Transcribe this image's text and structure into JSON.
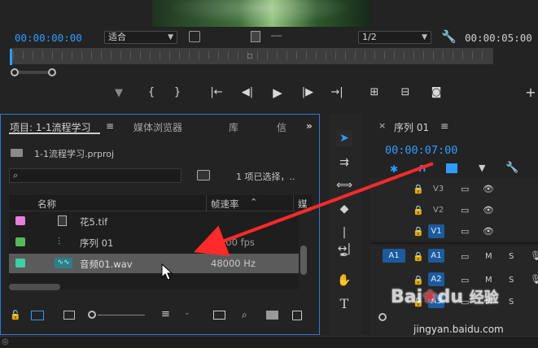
{
  "monitor": {
    "current_time": "00:00:00:00",
    "fit_label": "适合",
    "resolution": "1/2",
    "duration": "00:00:05:00"
  },
  "project_panel": {
    "tab_project": "项目: 1-1流程学习",
    "tab_media_browser": "媒体浏览器",
    "tab_library": "库",
    "tab_info": "信",
    "file_name": "1-1流程学习.prproj",
    "selection_status": "1 项已选择，..",
    "col_name": "名称",
    "col_framerate": "帧速率",
    "col_media": "媒",
    "items": [
      {
        "name": "花5.tif",
        "rate": "",
        "color": "#e680d8"
      },
      {
        "name": "序列 01",
        "rate": "25.00 fps",
        "color": "#58b85a"
      },
      {
        "name": "音频01.wav",
        "rate": "48000 Hz",
        "color": "#3ecfa3"
      }
    ]
  },
  "timeline": {
    "tab_label": "序列 01",
    "timecode": "00:00:07:00",
    "video_tracks": [
      "V3",
      "V2",
      "V1"
    ],
    "audio_tracks": [
      "A1",
      "A2",
      "A3"
    ],
    "source_patch": "A1",
    "mute_label": "M",
    "solo_label": "S"
  },
  "watermark": {
    "brand": "Bai",
    "brand2": "du",
    "brand_cn": "经验",
    "url": "jingyan.baidu.com"
  },
  "colors": {
    "accent": "#2f9cff",
    "arrow": "#ff2a2a",
    "panel_border": "#2f78d8"
  }
}
